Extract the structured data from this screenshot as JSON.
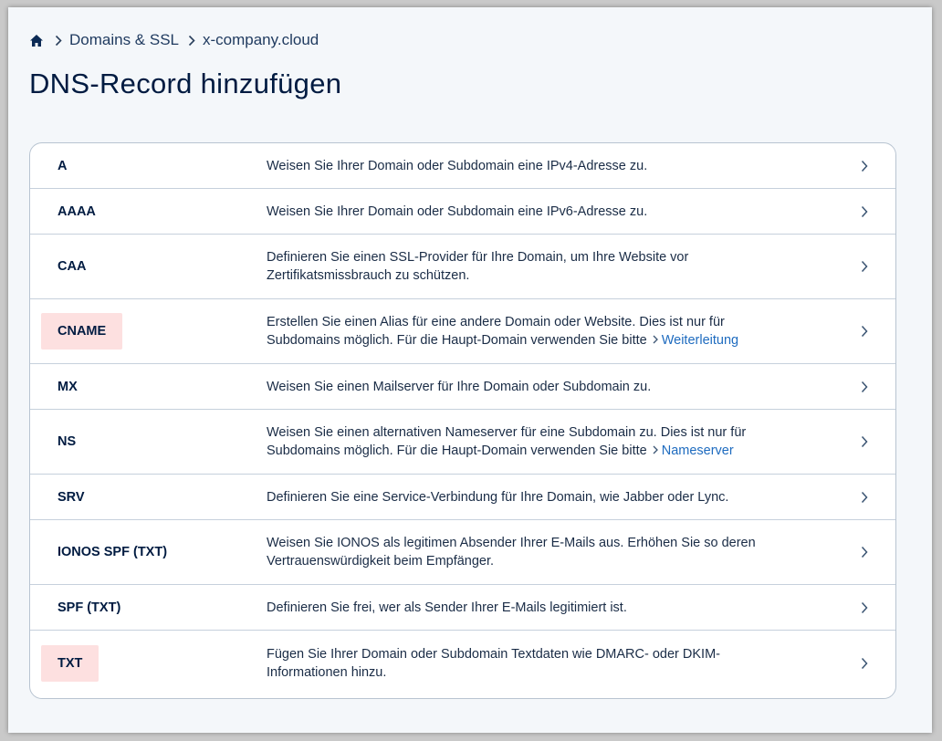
{
  "breadcrumb": {
    "home_icon": "home-icon",
    "items": [
      "Domains & SSL",
      "x-company.cloud"
    ]
  },
  "page": {
    "title": "DNS-Record hinzufügen"
  },
  "records": [
    {
      "type": "A",
      "desc": "Weisen Sie Ihrer Domain oder Subdomain eine IPv4-Adresse zu."
    },
    {
      "type": "AAAA",
      "desc": "Weisen Sie Ihrer Domain oder Subdomain eine IPv6-Adresse zu."
    },
    {
      "type": "CAA",
      "desc_line1": "Definieren Sie einen SSL-Provider für Ihre Domain, um Ihre Website vor",
      "desc_line2": "Zertifikatsmissbrauch zu schützen."
    },
    {
      "type": "CNAME",
      "desc_line1": "Erstellen Sie einen Alias für eine andere Domain oder Website. Dies ist nur für",
      "desc_line2": "Subdomains möglich. Für die Haupt-Domain verwenden Sie bitte",
      "link": "Weiterleitung"
    },
    {
      "type": "MX",
      "desc": "Weisen Sie einen Mailserver für Ihre Domain oder Subdomain zu."
    },
    {
      "type": "NS",
      "desc_line1": "Weisen Sie einen alternativen Nameserver für eine Subdomain zu. Dies ist nur für",
      "desc_line2": "Subdomains möglich. Für die Haupt-Domain verwenden Sie bitte",
      "link": "Nameserver"
    },
    {
      "type": "SRV",
      "desc": "Definieren Sie eine Service-Verbindung für Ihre Domain, wie Jabber oder Lync."
    },
    {
      "type": "IONOS SPF (TXT)",
      "desc_line1": "Weisen Sie IONOS als legitimen Absender Ihrer E-Mails aus. Erhöhen Sie so deren",
      "desc_line2": "Vertrauenswürdigkeit beim Empfänger."
    },
    {
      "type": "SPF (TXT)",
      "desc": "Definieren Sie frei, wer als Sender Ihrer E-Mails legitimiert ist."
    },
    {
      "type": "TXT",
      "desc_line1": "Fügen Sie Ihrer Domain oder Subdomain Textdaten wie DMARC- oder DKIM-",
      "desc_line2": "Informationen hinzu."
    }
  ],
  "colors": {
    "text": "#001b41",
    "link": "#1e6bbf",
    "highlight": "#fde0e0",
    "border": "#c6d0dc",
    "page_bg": "#f4f7fa"
  }
}
